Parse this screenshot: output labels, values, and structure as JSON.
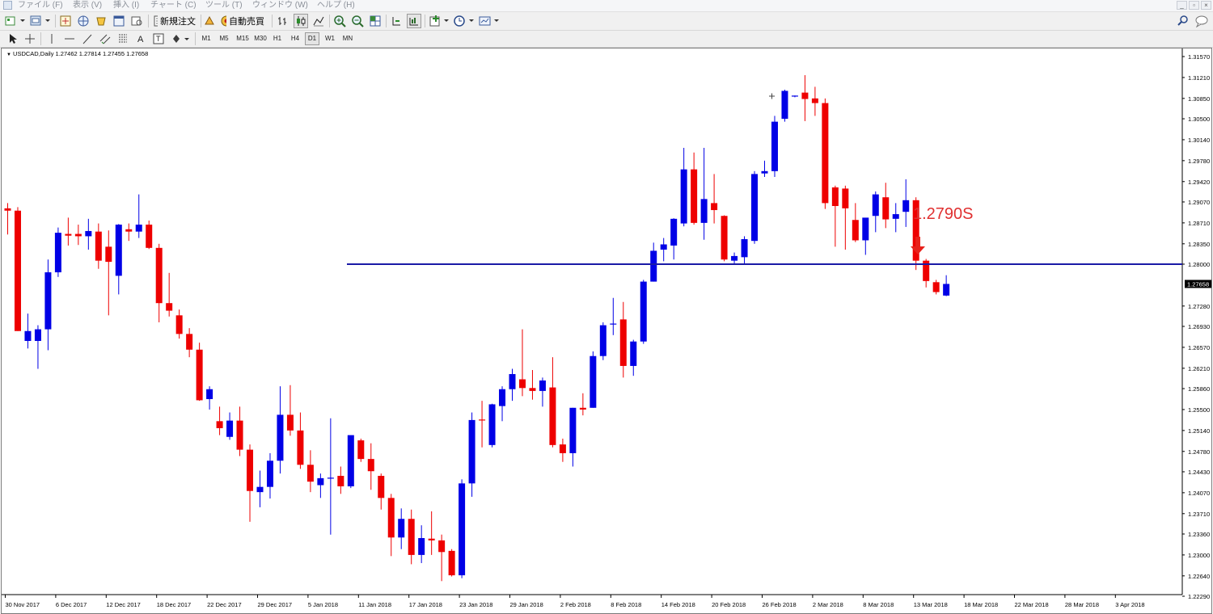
{
  "menu": {
    "items": [
      "ファイル (F)",
      "表示 (V)",
      "挿入 (I)",
      "チャート (C)",
      "ツール (T)",
      "ウィンドウ (W)",
      "ヘルプ (H)"
    ]
  },
  "toolbar": {
    "new_order_label": "新規注文",
    "auto_trading_label": "自動売買",
    "timeframes": [
      "M1",
      "M5",
      "M15",
      "M30",
      "H1",
      "H4",
      "D1",
      "W1",
      "MN"
    ],
    "active_timeframe": "D1"
  },
  "chart": {
    "symbol_info": "USDCAD,Daily  1.27462 1.27814 1.27455 1.27658",
    "current_price": "1.27658",
    "annotation": "1.2790S"
  },
  "chart_data": {
    "type": "candlestick",
    "symbol": "USDCAD",
    "timeframe": "Daily",
    "bull_color": "#0000e6",
    "bear_color": "#ee0000",
    "price_axis_labels": [
      "1.31570",
      "1.31210",
      "1.30850",
      "1.30500",
      "1.30140",
      "1.29780",
      "1.29420",
      "1.29070",
      "1.28710",
      "1.28350",
      "1.28000",
      "1.27280",
      "1.26930",
      "1.26570",
      "1.26210",
      "1.25860",
      "1.25500",
      "1.25140",
      "1.24780",
      "1.24430",
      "1.24070",
      "1.23710",
      "1.23360",
      "1.23000",
      "1.22640",
      "1.22290"
    ],
    "date_axis_labels": [
      "30 Nov 2017",
      "6 Dec 2017",
      "12 Dec 2017",
      "18 Dec 2017",
      "22 Dec 2017",
      "29 Dec 2017",
      "5 Jan 2018",
      "11 Jan 2018",
      "17 Jan 2018",
      "23 Jan 2018",
      "29 Jan 2018",
      "2 Feb 2018",
      "8 Feb 2018",
      "14 Feb 2018",
      "20 Feb 2018",
      "26 Feb 2018",
      "2 Mar 2018",
      "8 Mar 2018",
      "13 Mar 2018",
      "18 Mar 2018",
      "22 Mar 2018",
      "28 Mar 2018",
      "3 Apr 2018"
    ],
    "horizontal_line": 1.28,
    "candles": [
      {
        "o": 1.2896,
        "h": 1.2905,
        "l": 1.2851,
        "c": 1.2892
      },
      {
        "o": 1.2892,
        "h": 1.2898,
        "l": 1.2685,
        "c": 1.2685
      },
      {
        "o": 1.2668,
        "h": 1.2715,
        "l": 1.2655,
        "c": 1.2685
      },
      {
        "o": 1.2668,
        "h": 1.2695,
        "l": 1.262,
        "c": 1.2688
      },
      {
        "o": 1.2688,
        "h": 1.2808,
        "l": 1.2652,
        "c": 1.2786
      },
      {
        "o": 1.2786,
        "h": 1.2863,
        "l": 1.2778,
        "c": 1.2854
      },
      {
        "o": 1.2852,
        "h": 1.288,
        "l": 1.2832,
        "c": 1.2849
      },
      {
        "o": 1.2852,
        "h": 1.2868,
        "l": 1.2833,
        "c": 1.2848
      },
      {
        "o": 1.2848,
        "h": 1.2878,
        "l": 1.2825,
        "c": 1.2857
      },
      {
        "o": 1.2856,
        "h": 1.287,
        "l": 1.2792,
        "c": 1.2806
      },
      {
        "o": 1.283,
        "h": 1.2858,
        "l": 1.2712,
        "c": 1.2804
      },
      {
        "o": 1.278,
        "h": 1.2869,
        "l": 1.2748,
        "c": 1.2868
      },
      {
        "o": 1.286,
        "h": 1.287,
        "l": 1.284,
        "c": 1.2856
      },
      {
        "o": 1.2856,
        "h": 1.292,
        "l": 1.2845,
        "c": 1.2868
      },
      {
        "o": 1.2868,
        "h": 1.2875,
        "l": 1.2826,
        "c": 1.2828
      },
      {
        "o": 1.2828,
        "h": 1.2835,
        "l": 1.27,
        "c": 1.2733
      },
      {
        "o": 1.2733,
        "h": 1.2785,
        "l": 1.271,
        "c": 1.272
      },
      {
        "o": 1.2712,
        "h": 1.2722,
        "l": 1.2672,
        "c": 1.268
      },
      {
        "o": 1.268,
        "h": 1.269,
        "l": 1.264,
        "c": 1.2653
      },
      {
        "o": 1.2653,
        "h": 1.2665,
        "l": 1.2565,
        "c": 1.2566
      },
      {
        "o": 1.2568,
        "h": 1.259,
        "l": 1.255,
        "c": 1.2585
      },
      {
        "o": 1.253,
        "h": 1.2555,
        "l": 1.2506,
        "c": 1.2518
      },
      {
        "o": 1.2503,
        "h": 1.2545,
        "l": 1.2498,
        "c": 1.2531
      },
      {
        "o": 1.2531,
        "h": 1.2555,
        "l": 1.247,
        "c": 1.2481
      },
      {
        "o": 1.2481,
        "h": 1.249,
        "l": 1.2357,
        "c": 1.241
      },
      {
        "o": 1.2408,
        "h": 1.2445,
        "l": 1.2382,
        "c": 1.2417
      },
      {
        "o": 1.2417,
        "h": 1.2475,
        "l": 1.2397,
        "c": 1.2462
      },
      {
        "o": 1.2462,
        "h": 1.259,
        "l": 1.244,
        "c": 1.2541
      },
      {
        "o": 1.2541,
        "h": 1.2592,
        "l": 1.2505,
        "c": 1.2514
      },
      {
        "o": 1.2514,
        "h": 1.2545,
        "l": 1.2448,
        "c": 1.2455
      },
      {
        "o": 1.2455,
        "h": 1.248,
        "l": 1.2408,
        "c": 1.2426
      },
      {
        "o": 1.242,
        "h": 1.244,
        "l": 1.2398,
        "c": 1.2432
      },
      {
        "o": 1.2432,
        "h": 1.2535,
        "l": 1.2335,
        "c": 1.2432
      },
      {
        "o": 1.2436,
        "h": 1.2452,
        "l": 1.2405,
        "c": 1.2418
      },
      {
        "o": 1.2418,
        "h": 1.2505,
        "l": 1.2415,
        "c": 1.2506
      },
      {
        "o": 1.2497,
        "h": 1.25,
        "l": 1.246,
        "c": 1.2465
      },
      {
        "o": 1.2465,
        "h": 1.2492,
        "l": 1.2412,
        "c": 1.2444
      },
      {
        "o": 1.2436,
        "h": 1.244,
        "l": 1.2378,
        "c": 1.2398
      },
      {
        "o": 1.2398,
        "h": 1.2405,
        "l": 1.2298,
        "c": 1.233
      },
      {
        "o": 1.233,
        "h": 1.238,
        "l": 1.231,
        "c": 1.2362
      },
      {
        "o": 1.2362,
        "h": 1.2378,
        "l": 1.2284,
        "c": 1.23
      },
      {
        "o": 1.23,
        "h": 1.2351,
        "l": 1.2286,
        "c": 1.2329
      },
      {
        "o": 1.2328,
        "h": 1.2375,
        "l": 1.23,
        "c": 1.2325
      },
      {
        "o": 1.2325,
        "h": 1.2335,
        "l": 1.2255,
        "c": 1.2305
      },
      {
        "o": 1.2307,
        "h": 1.231,
        "l": 1.2263,
        "c": 1.2265
      },
      {
        "o": 1.2265,
        "h": 1.243,
        "l": 1.226,
        "c": 1.2423
      },
      {
        "o": 1.2423,
        "h": 1.2545,
        "l": 1.24,
        "c": 1.2532
      },
      {
        "o": 1.2532,
        "h": 1.2565,
        "l": 1.2485,
        "c": 1.253
      },
      {
        "o": 1.2489,
        "h": 1.256,
        "l": 1.2485,
        "c": 1.2559
      },
      {
        "o": 1.2556,
        "h": 1.259,
        "l": 1.253,
        "c": 1.2585
      },
      {
        "o": 1.2585,
        "h": 1.262,
        "l": 1.2565,
        "c": 1.2611
      },
      {
        "o": 1.2602,
        "h": 1.2688,
        "l": 1.2573,
        "c": 1.2587
      },
      {
        "o": 1.2587,
        "h": 1.2618,
        "l": 1.2567,
        "c": 1.2582
      },
      {
        "o": 1.2582,
        "h": 1.2605,
        "l": 1.2555,
        "c": 1.26
      },
      {
        "o": 1.2588,
        "h": 1.264,
        "l": 1.2485,
        "c": 1.2489
      },
      {
        "o": 1.249,
        "h": 1.25,
        "l": 1.246,
        "c": 1.2475
      },
      {
        "o": 1.2475,
        "h": 1.2553,
        "l": 1.2452,
        "c": 1.2553
      },
      {
        "o": 1.2553,
        "h": 1.2578,
        "l": 1.254,
        "c": 1.255
      },
      {
        "o": 1.2553,
        "h": 1.265,
        "l": 1.2553,
        "c": 1.2642
      },
      {
        "o": 1.2642,
        "h": 1.27,
        "l": 1.2635,
        "c": 1.2695
      },
      {
        "o": 1.2696,
        "h": 1.2742,
        "l": 1.2678,
        "c": 1.2697
      },
      {
        "o": 1.2705,
        "h": 1.2735,
        "l": 1.2605,
        "c": 1.2625
      },
      {
        "o": 1.2625,
        "h": 1.267,
        "l": 1.2608,
        "c": 1.2667
      },
      {
        "o": 1.2667,
        "h": 1.2773,
        "l": 1.2663,
        "c": 1.277
      },
      {
        "o": 1.277,
        "h": 1.2837,
        "l": 1.277,
        "c": 1.2823
      },
      {
        "o": 1.2825,
        "h": 1.2845,
        "l": 1.2805,
        "c": 1.2834
      },
      {
        "o": 1.2832,
        "h": 1.2879,
        "l": 1.2808,
        "c": 1.2878
      },
      {
        "o": 1.287,
        "h": 1.3,
        "l": 1.2865,
        "c": 1.2963
      },
      {
        "o": 1.2963,
        "h": 1.2992,
        "l": 1.2868,
        "c": 1.2871
      },
      {
        "o": 1.2871,
        "h": 1.3,
        "l": 1.2842,
        "c": 1.2912
      },
      {
        "o": 1.2905,
        "h": 1.2955,
        "l": 1.287,
        "c": 1.2893
      },
      {
        "o": 1.2883,
        "h": 1.2884,
        "l": 1.2805,
        "c": 1.2808
      },
      {
        "o": 1.2806,
        "h": 1.282,
        "l": 1.28,
        "c": 1.2814
      },
      {
        "o": 1.2812,
        "h": 1.2848,
        "l": 1.28,
        "c": 1.2843
      },
      {
        "o": 1.284,
        "h": 1.296,
        "l": 1.2835,
        "c": 1.2955
      },
      {
        "o": 1.2956,
        "h": 1.2978,
        "l": 1.295,
        "c": 1.296
      },
      {
        "o": 1.296,
        "h": 1.3055,
        "l": 1.295,
        "c": 1.3045
      },
      {
        "o": 1.305,
        "h": 1.31,
        "l": 1.3045,
        "c": 1.3098
      },
      {
        "o": 1.3089,
        "h": 1.309,
        "l": 1.3087,
        "c": 1.3089
      },
      {
        "o": 1.3095,
        "h": 1.3125,
        "l": 1.3046,
        "c": 1.3084
      },
      {
        "o": 1.3085,
        "h": 1.3105,
        "l": 1.3055,
        "c": 1.3077
      },
      {
        "o": 1.3077,
        "h": 1.3085,
        "l": 1.2895,
        "c": 1.2905
      },
      {
        "o": 1.2932,
        "h": 1.2935,
        "l": 1.283,
        "c": 1.29
      },
      {
        "o": 1.293,
        "h": 1.2935,
        "l": 1.2825,
        "c": 1.2896
      },
      {
        "o": 1.2876,
        "h": 1.2905,
        "l": 1.2838,
        "c": 1.2841
      },
      {
        "o": 1.2841,
        "h": 1.2875,
        "l": 1.2816,
        "c": 1.288
      },
      {
        "o": 1.2883,
        "h": 1.2925,
        "l": 1.2855,
        "c": 1.292
      },
      {
        "o": 1.2915,
        "h": 1.294,
        "l": 1.2862,
        "c": 1.2877
      },
      {
        "o": 1.2878,
        "h": 1.2905,
        "l": 1.2855,
        "c": 1.2886
      },
      {
        "o": 1.289,
        "h": 1.2946,
        "l": 1.2864,
        "c": 1.291
      },
      {
        "o": 1.291,
        "h": 1.2915,
        "l": 1.279,
        "c": 1.2806
      },
      {
        "o": 1.2806,
        "h": 1.2809,
        "l": 1.276,
        "c": 1.2771
      },
      {
        "o": 1.2769,
        "h": 1.2773,
        "l": 1.2748,
        "c": 1.2752
      },
      {
        "o": 1.2746,
        "h": 1.2781,
        "l": 1.2745,
        "c": 1.2766
      }
    ]
  }
}
